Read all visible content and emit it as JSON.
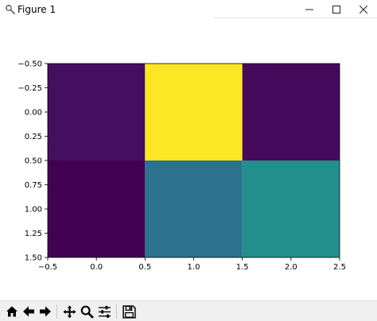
{
  "window": {
    "title": "Figure 1",
    "icon": "matplotlib-figure-icon",
    "controls": [
      "minimize-icon",
      "maximize-icon",
      "close-icon"
    ]
  },
  "toolbar": {
    "buttons": [
      "home-icon",
      "back-arrow-icon",
      "forward-arrow-icon",
      "pan-icon",
      "zoom-icon",
      "configure-subplots-icon",
      "save-icon"
    ]
  },
  "chart_data": {
    "type": "heatmap",
    "title": "",
    "xlabel": "",
    "ylabel": "",
    "rows": 2,
    "cols": 3,
    "values": [
      [
        0.1,
        1.0,
        0.05
      ],
      [
        0.0,
        0.4,
        0.55
      ]
    ],
    "colors": [
      [
        "#440f60",
        "#fde724",
        "#460a5d"
      ],
      [
        "#430154",
        "#2c718e",
        "#21908d"
      ]
    ],
    "colormap": "viridis",
    "xlim": [
      -0.5,
      2.5
    ],
    "ylim": [
      1.5,
      -0.5
    ],
    "x_ticks": [
      -0.5,
      0.0,
      0.5,
      1.0,
      1.5,
      2.0,
      2.5
    ],
    "y_ticks": [
      -0.5,
      -0.25,
      0.0,
      0.25,
      0.5,
      0.75,
      1.0,
      1.25,
      1.5
    ],
    "x_tick_labels": [
      "−0.5",
      "0.0",
      "0.5",
      "1.0",
      "1.5",
      "2.0",
      "2.5"
    ],
    "y_tick_labels": [
      "−0.50",
      "−0.25",
      "0.00",
      "0.25",
      "0.50",
      "0.75",
      "1.00",
      "1.25",
      "1.50"
    ],
    "grid": false
  }
}
